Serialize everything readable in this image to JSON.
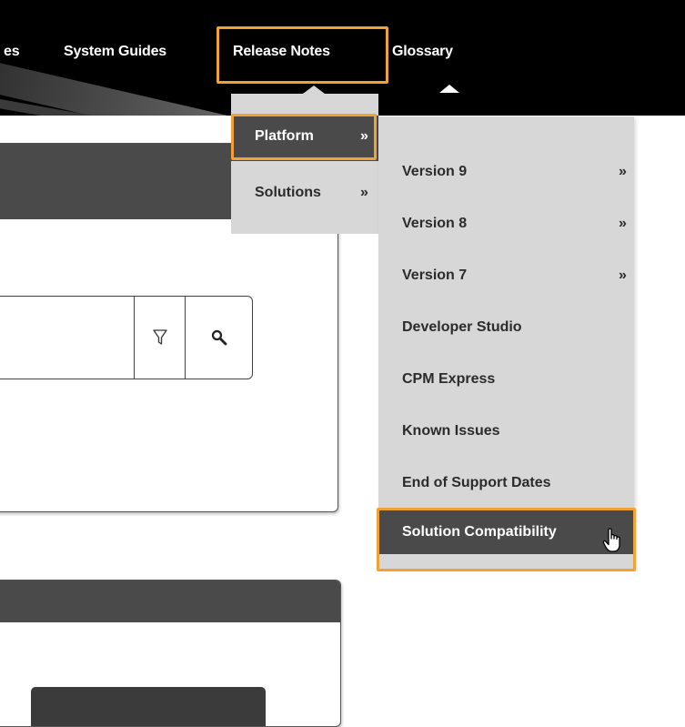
{
  "topnav": {
    "partial_label": "es",
    "items": [
      {
        "label": "System Guides"
      },
      {
        "label": "Release Notes",
        "highlighted": true
      },
      {
        "label": "Glossary"
      }
    ]
  },
  "menu_level1": {
    "items": [
      {
        "label": "Platform",
        "chevron": "»",
        "active": true
      },
      {
        "label": "Solutions",
        "chevron": "»"
      }
    ]
  },
  "menu_level2": {
    "items": [
      {
        "label": "Version 9",
        "chevron": "»"
      },
      {
        "label": "Version 8",
        "chevron": "»"
      },
      {
        "label": "Version 7",
        "chevron": "»"
      },
      {
        "label": "Developer Studio"
      },
      {
        "label": "CPM Express"
      },
      {
        "label": "Known Issues"
      },
      {
        "label": "End of Support Dates"
      },
      {
        "label": "Solution Compatibility",
        "active": true
      }
    ]
  },
  "icons": {
    "filter": "filter-icon",
    "search": "search-icon",
    "cursor": "hand-pointer-icon"
  },
  "colors": {
    "highlight": "#f0a237",
    "menu_bg": "#d7d7d7",
    "active_bg": "#4a4a4a",
    "nav_bg": "#000000"
  }
}
